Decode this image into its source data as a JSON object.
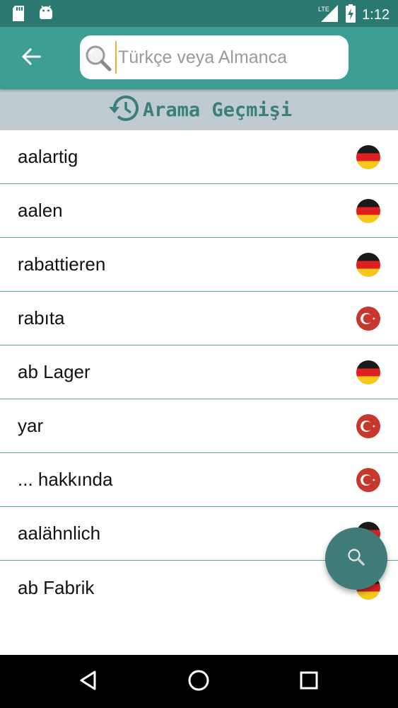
{
  "status_bar": {
    "time": "1:12",
    "network": "LTE",
    "icons": [
      "sd-card-icon",
      "android-icon",
      "signal-icon",
      "battery-charging-icon"
    ]
  },
  "app_bar": {
    "back_icon": "arrow-left-icon",
    "search": {
      "icon": "magnifier-icon",
      "placeholder": "Türkçe veya Almanca",
      "value": ""
    }
  },
  "history_header": {
    "icon": "history-icon",
    "title": "Arama Geçmişi"
  },
  "history": [
    {
      "word": "aalartig",
      "lang": "de"
    },
    {
      "word": "aalen",
      "lang": "de"
    },
    {
      "word": "rabattieren",
      "lang": "de"
    },
    {
      "word": "rabıta",
      "lang": "tr"
    },
    {
      "word": "ab Lager",
      "lang": "de"
    },
    {
      "word": "yar",
      "lang": "tr"
    },
    {
      "word": "... hakkında",
      "lang": "tr"
    },
    {
      "word": "aalähnlich",
      "lang": "de"
    },
    {
      "word": "ab Fabrik",
      "lang": "de"
    }
  ],
  "fab": {
    "icon": "search-icon"
  },
  "colors": {
    "status_bar": "#2a7a72",
    "app_bar": "#3d9e95",
    "header_bg": "#bfcbd0",
    "header_text": "#39807a",
    "divider": "#5aa89f",
    "fab": "#3f7b78"
  },
  "nav_bar": {
    "buttons": [
      "back-triangle-icon",
      "home-circle-icon",
      "recents-square-icon"
    ]
  }
}
